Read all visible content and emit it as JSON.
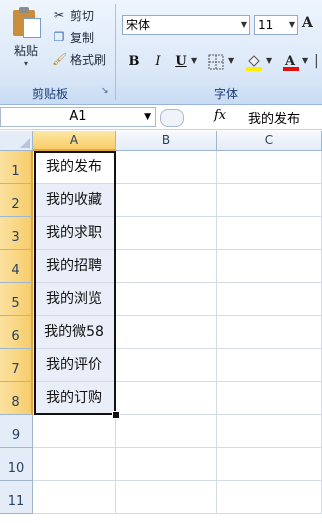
{
  "ribbon": {
    "clipboard": {
      "paste_label": "粘贴",
      "cut_label": "剪切",
      "copy_label": "复制",
      "format_painter_label": "格式刷",
      "group_label": "剪贴板"
    },
    "font": {
      "font_name": "宋体",
      "font_size": "11",
      "bold": "B",
      "italic": "I",
      "underline": "U",
      "grow": "A",
      "group_label": "字体"
    }
  },
  "formula_bar": {
    "name_box": "A1",
    "fx": "fx",
    "value": "我的发布"
  },
  "columns": [
    "A",
    "B",
    "C"
  ],
  "rows": [
    {
      "num": "1",
      "a": "我的发布"
    },
    {
      "num": "2",
      "a": "我的收藏"
    },
    {
      "num": "3",
      "a": "我的求职"
    },
    {
      "num": "4",
      "a": "我的招聘"
    },
    {
      "num": "5",
      "a": "我的浏览"
    },
    {
      "num": "6",
      "a": "我的微58"
    },
    {
      "num": "7",
      "a": "我的评价"
    },
    {
      "num": "8",
      "a": "我的订购"
    },
    {
      "num": "9",
      "a": ""
    },
    {
      "num": "10",
      "a": ""
    },
    {
      "num": "11",
      "a": ""
    }
  ],
  "colors": {
    "ribbon_bg": "#dbe8f8",
    "selection_header": "#f8cd6a",
    "font_color_red": "#e01010",
    "fill_color_yellow": "#ffee00"
  }
}
